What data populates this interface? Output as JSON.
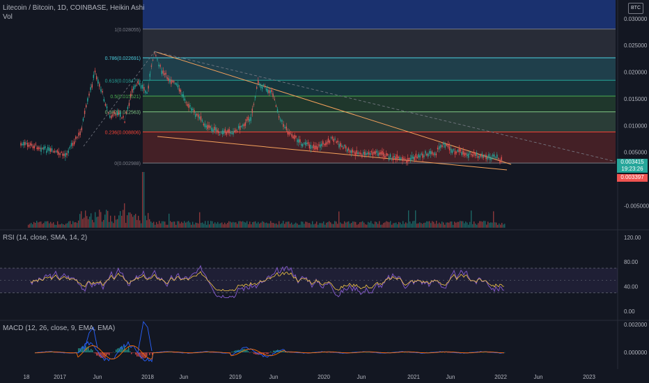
{
  "header": {
    "title": "Litecoin / Bitcoin, 1D, COINBASE, Heikin Ashi",
    "vol_label": "Vol",
    "currency_badge": "BTC"
  },
  "price_axis": {
    "ticks": [
      "0.030000",
      "0.025000",
      "0.020000",
      "0.015000",
      "0.010000",
      "0.005000",
      "-0.005000"
    ],
    "last_price": "0.003415",
    "countdown": "19:23:26",
    "low_tag": "0.003397",
    "last_price_color": "#26a69a",
    "low_tag_color": "#ef5350"
  },
  "fib_levels": [
    {
      "label": "1(0.028055)",
      "value": 0.028055,
      "color": "#787b86"
    },
    {
      "label": "0.786(0.022691)",
      "value": 0.022691,
      "color": "#4dd0e1"
    },
    {
      "label": "0.618(0.018479)",
      "value": 0.018479,
      "color": "#26a69a"
    },
    {
      "label": "0.5(0.015521)",
      "value": 0.015521,
      "color": "#4caf50"
    },
    {
      "label": "0.382(0.012563)",
      "value": 0.012563,
      "color": "#81c784"
    },
    {
      "label": "0.236(0.008806)",
      "value": 0.008806,
      "color": "#f44336"
    },
    {
      "label": "0(0.002988)",
      "value": 0.002988,
      "color": "#787b86"
    }
  ],
  "time_axis": {
    "labels": [
      "18",
      "2017",
      "Jun",
      "2018",
      "Jun",
      "2019",
      "Jun",
      "2020",
      "Jun",
      "2021",
      "Jun",
      "2022",
      "Jun",
      "2023"
    ]
  },
  "rsi": {
    "title": "RSI (14, close, SMA, 14, 2)",
    "ticks": [
      "120.00",
      "80.00",
      "40.00",
      "0.00"
    ],
    "band_upper": 70,
    "band_lower": 30
  },
  "macd": {
    "title": "MACD (12, 26, close, 9, EMA, EMA)",
    "ticks": [
      "0.002000",
      "0.000000"
    ]
  },
  "chart_data": {
    "type": "line",
    "title": "Litecoin / Bitcoin, 1D, COINBASE, Heikin Ashi",
    "x": [
      "2016-08",
      "2016-10",
      "2016-12",
      "2017-02",
      "2017-03",
      "2017-04",
      "2017-05",
      "2017-06",
      "2017-07",
      "2017-08",
      "2017-09",
      "2017-10",
      "2017-11",
      "2017-12",
      "2018-01",
      "2018-02",
      "2018-03",
      "2018-05",
      "2018-07",
      "2018-09",
      "2018-11",
      "2019-01",
      "2019-03",
      "2019-04",
      "2019-06",
      "2019-07",
      "2019-08",
      "2019-10",
      "2019-12",
      "2020-02",
      "2020-04",
      "2020-06",
      "2020-08",
      "2020-10",
      "2020-12",
      "2021-02",
      "2021-04",
      "2021-05",
      "2021-06",
      "2021-08",
      "2021-10",
      "2021-12",
      "2022-01"
    ],
    "series": [
      {
        "values": [
          0.0065,
          0.0062,
          0.0052,
          0.0045,
          0.0068,
          0.0085,
          0.0145,
          0.02,
          0.016,
          0.0115,
          0.0125,
          0.011,
          0.0165,
          0.018,
          0.016,
          0.024,
          0.02,
          0.0175,
          0.013,
          0.01,
          0.0085,
          0.009,
          0.0115,
          0.018,
          0.016,
          0.011,
          0.009,
          0.0065,
          0.006,
          0.0075,
          0.0055,
          0.0045,
          0.005,
          0.004,
          0.0035,
          0.0045,
          0.005,
          0.0068,
          0.0055,
          0.0048,
          0.0042,
          0.004,
          0.0034
        ]
      }
    ],
    "ylim": [
      -0.0095,
      0.0335
    ],
    "y_ticks": [
      0.03,
      0.025,
      0.02,
      0.015,
      0.01,
      0.005,
      -0.005
    ],
    "grid": false
  }
}
